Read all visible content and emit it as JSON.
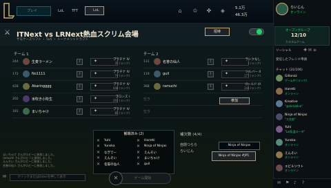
{
  "topbar": {
    "play_label": "プレイ",
    "nav": [
      "LoL",
      "TFT"
    ],
    "lol_badge": "LoL",
    "currency1": "5.1万",
    "currency2": "46.3万"
  },
  "room": {
    "title": "ITNext vs LRNext熱血スクリム会場",
    "subtitle": "サモナーズリフト ・ 5v5 ・ トーナメントドラフト",
    "invite_label": "招待",
    "team1_label": "チーム 1",
    "team2_label": "チーム 2",
    "team1": [
      {
        "num": "244",
        "name": "生麦ラーメン",
        "role": "✦",
        "rank": "プラチナ IV",
        "rank_sub": "35 (ランク)"
      },
      {
        "num": "172",
        "name": "No1111",
        "role": "✦",
        "rank": "プラチナ IV",
        "rank_sub": "74 (ランク)"
      },
      {
        "num": "428",
        "name": "Akaringggg",
        "role": "✦",
        "rank": "プラチナ IV",
        "rank_sub": "448 (ランク)"
      },
      {
        "num": "202",
        "name": "米吹き小吹生",
        "role": "✦",
        "rank": "ブロンズ I",
        "rank_sub": "202 (ランク)"
      },
      {
        "num": "181",
        "name": "まいちゃけ",
        "role": "✦",
        "rank": "プラチナ IV",
        "rank_sub": "85 (ランク)"
      }
    ],
    "team2": [
      {
        "num": "131",
        "name": "名誉の仙人",
        "role": "✦",
        "rank": "ランクなし",
        "rank_sub": "1 (ランク)"
      },
      {
        "num": "119",
        "name": "guil",
        "role": "✦",
        "rank": "シルバー II",
        "rank_sub": "177 (ランク)"
      },
      {
        "num": "368",
        "name": "ramuchi",
        "role": "✦",
        "rank": "ゴールド III",
        "rank_sub": "144 (ランク)"
      }
    ],
    "empty_slot": "空き",
    "join_label": "参加"
  },
  "spectators": {
    "title": "観戦済み (2)",
    "left": [
      "Yuhi",
      "Yunska",
      "なぎでー",
      "えんそい",
      "名誉の仙人"
    ],
    "right": [
      "Haretti",
      "Ninja of Ninjas",
      "えんそい",
      "まいちゃけ",
      "guil"
    ]
  },
  "bench": {
    "title": "補欠数 (4/4)",
    "items": [
      "自閉つらら",
      "らいじん"
    ]
  },
  "tooltip": {
    "title": "Ninja of Ninjas",
    "sub": "Ninja of Ninjas #JP1"
  },
  "chat": {
    "log": [
      "まいちゃけ さんがロビーに参加しました。",
      "ramuchi さんがロビーに参加しました。",
      "えんそい さんがロビーに参加しました。",
      "名誉の仙人 さんがロビーに参加しました。"
    ],
    "placeholder": "クリックまたはEnterを押して表示"
  },
  "start_label": "ゲーム開始",
  "sidebar": {
    "user_name": "らいじん",
    "user_status": "オンライン",
    "group_title": "オープングループ",
    "group_count": "12/10",
    "group_sub": "カスタムゲーム",
    "social_label": "ソーシャル",
    "fav_label": "受信したフレンド申請",
    "chat_label": "チャット (31/106)",
    "friends": [
      {
        "name": "Gillanzz",
        "status": "ゲーム中 (ランク)",
        "color": "#6b8e5a"
      },
      {
        "name": "Haretti",
        "status": "オンライン",
        "color": "#8a6b4a"
      },
      {
        "name": "Kreative",
        "status": "\"@skreative\"",
        "color": "#5a7a9a"
      },
      {
        "name": "Ninja of Ninjas",
        "status": "\"ス名前\"",
        "color": "#4a4a6a"
      },
      {
        "name": "Yuhi",
        "status": "\"Lol気温ロータ\"",
        "color": "#7a5a8a"
      },
      {
        "name": "Yunska",
        "status": "オンライン",
        "color": "#5a8a7a"
      },
      {
        "name": "えんそい",
        "status": "オンライン",
        "color": "#8a7a4a"
      },
      {
        "name": "エビルソウト",
        "status": "オンライン",
        "color": "#6a4a4a"
      }
    ]
  },
  "colors": {
    "accent": "#c8aa6e",
    "online": "#1ad66c",
    "bg": "#010a13"
  }
}
